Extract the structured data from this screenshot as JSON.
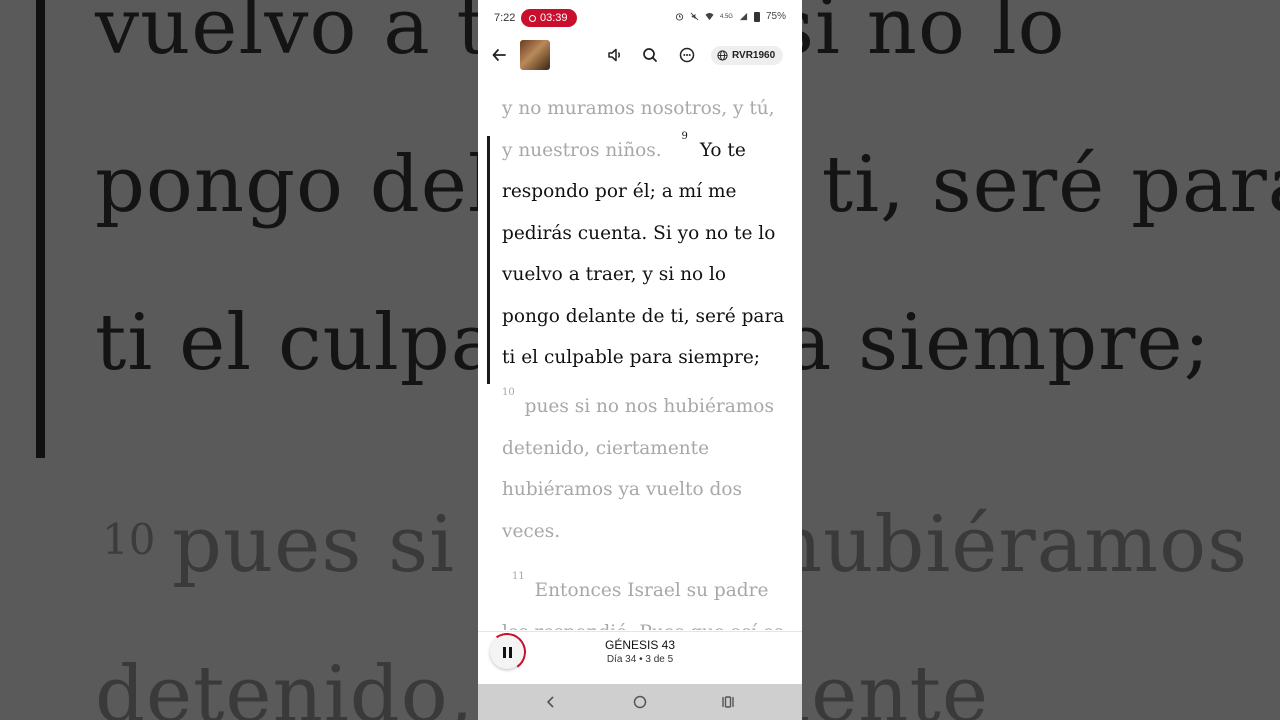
{
  "background": {
    "lines": [
      "vuelvo a traer, y si no lo",
      "pongo delante de ti, seré para",
      "ti el culpable para siempre;",
      "pues si no nos hubiéramos",
      "detenido, ciertamente"
    ],
    "verse_number": "10"
  },
  "status_bar": {
    "time": "7:22",
    "recording_time": "03:39",
    "network": "4.5G",
    "battery": "75%"
  },
  "top_bar": {
    "back_icon": "arrow-left-icon",
    "thumbnail_icon": "book-thumbnail",
    "audio_icon": "speaker-icon",
    "search_icon": "search-icon",
    "more_icon": "more-icon",
    "version_icon": "globe-icon",
    "version": "RVR1960"
  },
  "content": {
    "lines": [
      {
        "text": "y no muramos nosotros, y tú,",
        "style": "dim"
      },
      {
        "text": "y nuestros niños.",
        "style": "dim",
        "verse": "9",
        "after": "Yo te"
      },
      {
        "text": "respondo por él; a mí me",
        "style": "dark"
      },
      {
        "text": "pedirás cuenta. Si yo no te lo",
        "style": "dark"
      },
      {
        "text": "vuelvo a traer, y si no lo",
        "style": "dark"
      },
      {
        "text": "pongo delante de ti, seré para",
        "style": "dark"
      },
      {
        "text": "ti el culpable para siempre;",
        "style": "dark"
      },
      {
        "text": "pues si no nos hubiéramos",
        "style": "dim",
        "verse": "10"
      },
      {
        "text": "detenido, ciertamente",
        "style": "dim"
      },
      {
        "text": "hubiéramos ya vuelto dos",
        "style": "dim"
      },
      {
        "text": "veces.",
        "style": "dim"
      },
      {
        "text": "Entonces Israel su padre",
        "style": "dim",
        "verse": "11"
      },
      {
        "text": "les respondió: Pues que así es,",
        "style": "dim"
      }
    ]
  },
  "player": {
    "title": "GÉNESIS 43",
    "subtitle": "Día 34 • 3 de 5",
    "pause_icon": "pause-icon"
  },
  "nav_bar": {
    "back": "nav-back-icon",
    "home": "nav-home-icon",
    "recents": "nav-recents-icon"
  },
  "colors": {
    "accent": "#c8102e",
    "text_dark": "#111111",
    "text_dim": "#a8a8a8"
  }
}
